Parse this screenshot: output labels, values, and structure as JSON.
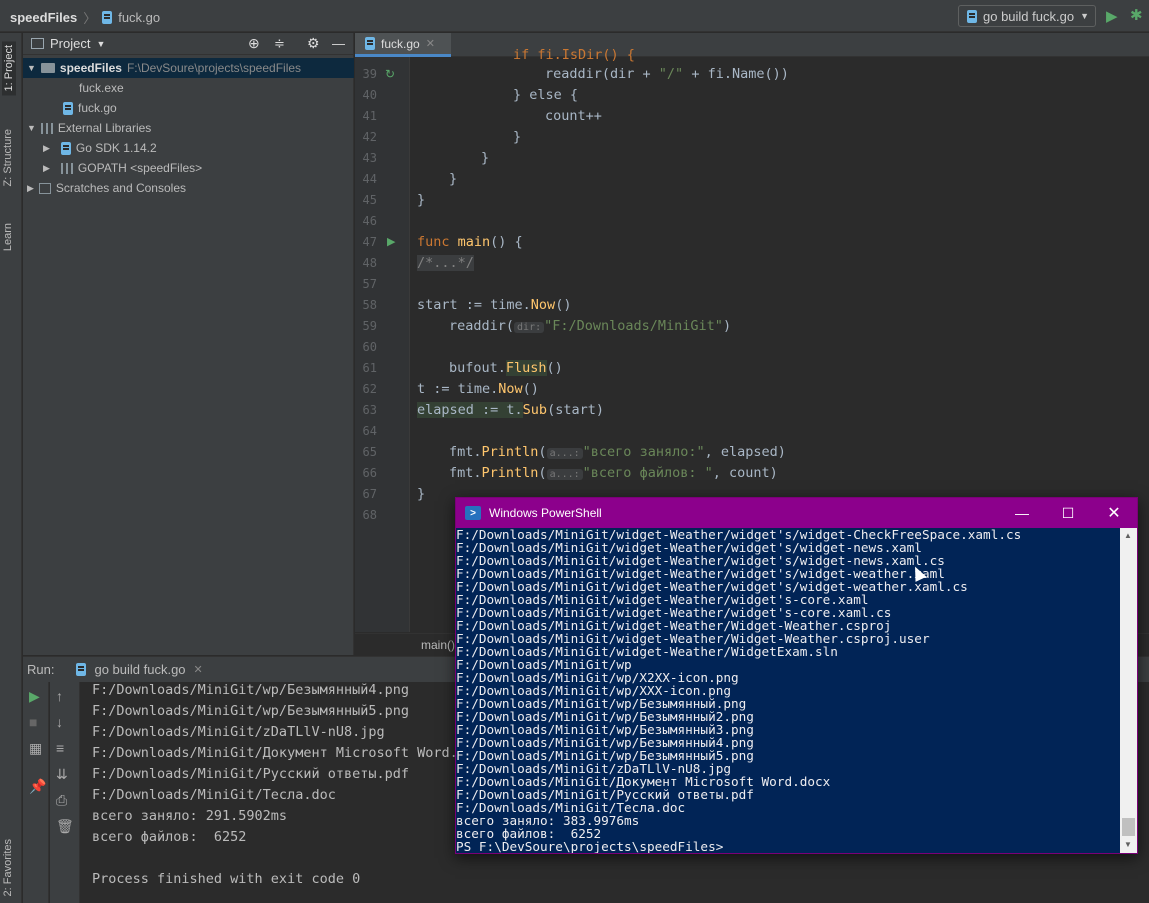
{
  "topbar": {
    "project": "speedFiles",
    "file": "fuck.go",
    "run_config": "go build fuck.go"
  },
  "left_strip": {
    "project": "1: Project",
    "structure": "Z: Structure",
    "learn": "Learn",
    "favorites": "2: Favorites"
  },
  "project_panel": {
    "title": "Project",
    "tree": [
      {
        "label": "speedFiles",
        "path": "F:\\DevSoure\\projects\\speedFiles"
      },
      {
        "label": "fuck.exe"
      },
      {
        "label": "fuck.go"
      },
      {
        "label": "External Libraries"
      },
      {
        "label": "Go SDK 1.14.2"
      },
      {
        "label": "GOPATH <speedFiles>"
      },
      {
        "label": "Scratches and Consoles"
      }
    ]
  },
  "editor": {
    "tab": "fuck.go",
    "line_numbers": [
      "39",
      "40",
      "41",
      "42",
      "43",
      "44",
      "45",
      "46",
      "47",
      "48",
      "57",
      "58",
      "59",
      "60",
      "61",
      "62",
      "63",
      "64",
      "65",
      "66",
      "67",
      "68"
    ],
    "code": {
      "l38": "if fi.IsDir() {",
      "l39a": "readdir(dir + ",
      "l39b": "\"/\"",
      "l39c": " + fi.",
      "l39d": "Name",
      "l39e": "())",
      "l40": "} else {",
      "l41": "count++",
      "l42": "}",
      "l43": "}",
      "l44": "}",
      "l45": "}",
      "l47a": "func ",
      "l47b": "main",
      "l47c": "() {",
      "l48": "/*...*/",
      "l58a": "start := time.",
      "l58b": "Now",
      "l58c": "()",
      "l59a": "readdir(",
      "l59hint": "dir:",
      "l59b": "\"F:/Downloads/MiniGit\"",
      "l59c": ")",
      "l61a": "bufout.",
      "l61b": "Flush",
      "l61c": "()",
      "l62a": "t := time.",
      "l62b": "Now",
      "l62c": "()",
      "l63a": "elapsed := t.",
      "l63b": "Sub",
      "l63c": "(start)",
      "l65a": "fmt.",
      "l65b": "Println",
      "l65c": "(",
      "l65hint": "a...:",
      "l65d": "\"всего заняло:\"",
      "l65e": ", elapsed)",
      "l66a": "fmt.",
      "l66b": "Println",
      "l66c": "(",
      "l66hint": "a...:",
      "l66d": "\"всего файлов: \"",
      "l66e": ", count)",
      "l67": "}"
    },
    "breadcrumb": "main()"
  },
  "run": {
    "label": "Run:",
    "tab": "go build fuck.go",
    "output": [
      "F:/Downloads/MiniGit/wp/Безымянный4.png",
      "F:/Downloads/MiniGit/wp/Безымянный5.png",
      "F:/Downloads/MiniGit/zDaTLlV-nU8.jpg",
      "F:/Downloads/MiniGit/Документ Microsoft Word.d",
      "F:/Downloads/MiniGit/Русский ответы.pdf",
      "F:/Downloads/MiniGit/Тесла.doc",
      "всего заняло: 291.5902ms",
      "всего файлов:  6252",
      "",
      "Process finished with exit code 0"
    ]
  },
  "powershell": {
    "title": "Windows PowerShell",
    "lines": [
      "F:/Downloads/MiniGit/widget-Weather/widget's/widget-CheckFreeSpace.xaml.cs",
      "F:/Downloads/MiniGit/widget-Weather/widget's/widget-news.xaml",
      "F:/Downloads/MiniGit/widget-Weather/widget's/widget-news.xaml.cs",
      "F:/Downloads/MiniGit/widget-Weather/widget's/widget-weather.xaml",
      "F:/Downloads/MiniGit/widget-Weather/widget's/widget-weather.xaml.cs",
      "F:/Downloads/MiniGit/widget-Weather/widget's-core.xaml",
      "F:/Downloads/MiniGit/widget-Weather/widget's-core.xaml.cs",
      "F:/Downloads/MiniGit/widget-Weather/Widget-Weather.csproj",
      "F:/Downloads/MiniGit/widget-Weather/Widget-Weather.csproj.user",
      "F:/Downloads/MiniGit/widget-Weather/WidgetExam.sln",
      "F:/Downloads/MiniGit/wp",
      "F:/Downloads/MiniGit/wp/X2XX-icon.png",
      "F:/Downloads/MiniGit/wp/XXX-icon.png",
      "F:/Downloads/MiniGit/wp/Безымянный.png",
      "F:/Downloads/MiniGit/wp/Безымянный2.png",
      "F:/Downloads/MiniGit/wp/Безымянный3.png",
      "F:/Downloads/MiniGit/wp/Безымянный4.png",
      "F:/Downloads/MiniGit/wp/Безымянный5.png",
      "F:/Downloads/MiniGit/zDaTLlV-nU8.jpg",
      "F:/Downloads/MiniGit/Документ Microsoft Word.docx",
      "F:/Downloads/MiniGit/Русский ответы.pdf",
      "F:/Downloads/MiniGit/Тесла.doc",
      "всего заняло: 383.9976ms",
      "всего файлов:  6252",
      "PS F:\\DevSoure\\projects\\speedFiles>"
    ]
  },
  "colors": {
    "accent": "#4a88c7",
    "powershell_bg": "#012456",
    "powershell_title": "#8c008c",
    "run_green": "#59a869"
  }
}
